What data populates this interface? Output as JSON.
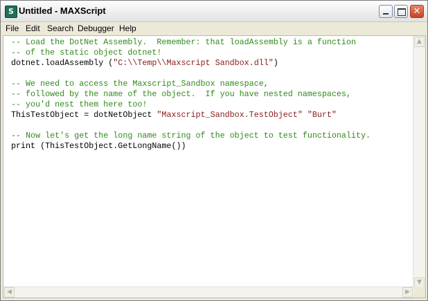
{
  "window": {
    "title": "Untitled - MAXScript",
    "icon": "maxscript-app-icon",
    "icon_glyph": "S",
    "controls": {
      "minimize": "minimize-icon",
      "maximize": "maximize-icon",
      "close": "close-icon",
      "close_glyph": "✕"
    }
  },
  "menubar": {
    "items": [
      "File",
      "Edit",
      "Search",
      "Debugger",
      "Help"
    ]
  },
  "editor": {
    "lines": [
      [
        {
          "t": "-- Load the DotNet Assembly.  Remember: that loadAssembly is a function",
          "c": "comment"
        }
      ],
      [
        {
          "t": "-- of the static object dotnet!",
          "c": "comment"
        }
      ],
      [
        {
          "t": "dotnet.loadAssembly (",
          "c": "plain"
        },
        {
          "t": "\"C:\\\\Temp\\\\Maxscript Sandbox.dll\"",
          "c": "string"
        },
        {
          "t": ")",
          "c": "plain"
        }
      ],
      [
        {
          "t": "",
          "c": "plain"
        }
      ],
      [
        {
          "t": "-- We need to access the Maxscript_Sandbox namespace,",
          "c": "comment"
        }
      ],
      [
        {
          "t": "-- followed by the name of the object.  If you have nested namespaces,",
          "c": "comment"
        }
      ],
      [
        {
          "t": "-- you'd nest them here too!",
          "c": "comment"
        }
      ],
      [
        {
          "t": "ThisTestObject = dotNetObject ",
          "c": "plain"
        },
        {
          "t": "\"Maxscript_Sandbox.TestObject\"",
          "c": "string"
        },
        {
          "t": " ",
          "c": "plain"
        },
        {
          "t": "\"Burt\"",
          "c": "string"
        }
      ],
      [
        {
          "t": "",
          "c": "plain"
        }
      ],
      [
        {
          "t": "-- Now let's get the long name string of the object to test functionality.",
          "c": "comment"
        }
      ],
      [
        {
          "t": "print (ThisTestObject.GetLongName())",
          "c": "plain"
        }
      ]
    ]
  },
  "scrollbars": {
    "up": "scroll-up-arrow-icon",
    "down": "scroll-down-arrow-icon",
    "left": "scroll-left-arrow-icon",
    "right": "scroll-right-arrow-icon",
    "up_glyph": "▲",
    "down_glyph": "▼",
    "left_glyph": "◀",
    "right_glyph": "▶"
  },
  "colors": {
    "comment": "#2f8a1a",
    "string": "#8a1a1a",
    "plain": "#000000"
  }
}
